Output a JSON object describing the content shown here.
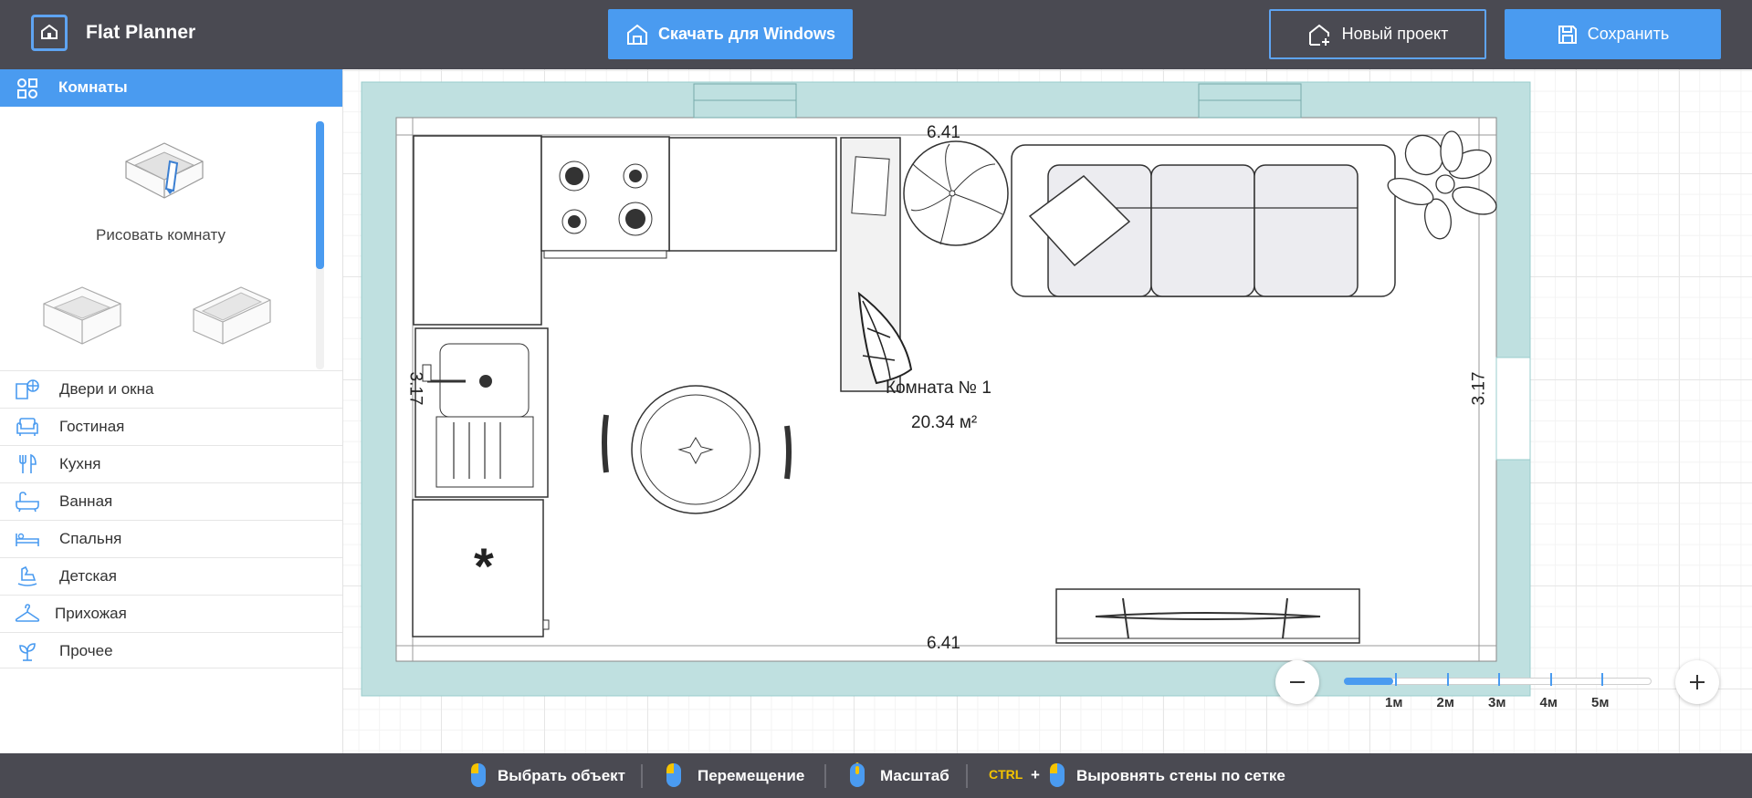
{
  "header": {
    "app_title": "Flat Planner",
    "download_label": "Скачать для Windows",
    "new_project_label": "Новый проект",
    "save_label": "Сохранить"
  },
  "sidebar": {
    "rooms_label": "Комнаты",
    "draw_room_label": "Рисовать комнату",
    "categories": [
      {
        "label": "Двери и окна",
        "icon": "door-window-icon"
      },
      {
        "label": "Гостиная",
        "icon": "armchair-icon"
      },
      {
        "label": "Кухня",
        "icon": "fork-knife-icon"
      },
      {
        "label": "Ванная",
        "icon": "bathtub-icon"
      },
      {
        "label": "Спальня",
        "icon": "bed-icon"
      },
      {
        "label": "Детская",
        "icon": "rocking-horse-icon"
      },
      {
        "label": "Прихожая",
        "icon": "hanger-icon"
      },
      {
        "label": "Прочее",
        "icon": "plant-icon"
      }
    ]
  },
  "plan": {
    "room_name": "Комната №  1",
    "room_area": "20.34 м²",
    "dim_top": "6.41",
    "dim_bottom": "6.41",
    "dim_left": "3.17",
    "dim_right": "3.17"
  },
  "zoom": {
    "scale_labels": [
      "1м",
      "2м",
      "3м",
      "4м",
      "5м"
    ],
    "level_fraction": 0.16
  },
  "footer": {
    "select_label": "Выбрать объект",
    "move_label": "Перемещение",
    "zoom_label": "Масштаб",
    "ctrl_label": "CTRL",
    "plus_label": "+",
    "align_label": "Выровнять стены по сетке"
  },
  "colors": {
    "accent": "#4a9bf0",
    "bar": "#4a4a52",
    "wall": "#bfe0e0"
  }
}
